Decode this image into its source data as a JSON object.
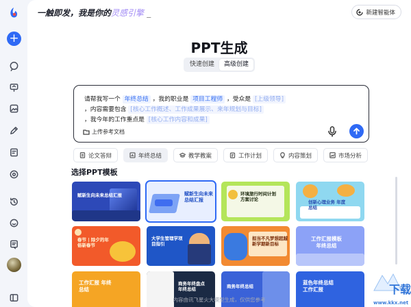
{
  "header": {
    "slogan_prefix": "一触即发，我是你的",
    "slogan_highlight": "灵感引擎",
    "slogan_cursor": "_",
    "new_agent_label": "新建智能体"
  },
  "main": {
    "title": "PPT生成",
    "modes": [
      "快速创建",
      "高级创建"
    ],
    "active_mode": "高级创建"
  },
  "prompt": {
    "line1": {
      "a": "请帮我写一个",
      "chip1": "年终总结",
      "b": "，我的职业是",
      "chip2": "项目工程师",
      "c": "，受众是",
      "chip3": "[上级领导]"
    },
    "line2": {
      "a": "，内容需要包含",
      "chip1": "[核心工作概述、工作成果展示、来年规划与目标]"
    },
    "line3": {
      "a": "，我今年的工作重点是",
      "chip1": "[核心工作内容和成果]"
    },
    "upload_label": "上传参考文档"
  },
  "categories": [
    {
      "label": "论文答辩",
      "icon": "document-icon",
      "active": false
    },
    {
      "label": "年终总结",
      "icon": "chart-icon",
      "active": true
    },
    {
      "label": "教学教案",
      "icon": "graduation-cap-icon",
      "active": false
    },
    {
      "label": "工作计划",
      "icon": "clipboard-icon",
      "active": false
    },
    {
      "label": "内容策划",
      "icon": "lightbulb-icon",
      "active": false
    },
    {
      "label": "市场分析",
      "icon": "trend-icon",
      "active": false
    }
  ],
  "templates_section": {
    "title": "选择PPT模板",
    "row1": [
      {
        "title": "赋新生向未来总结汇报",
        "bg": "#2d49b8"
      },
      {
        "title": "赋新生向未来\n总结汇报",
        "bg": "#e8efff",
        "selected": true
      },
      {
        "title": "环境旅行时间计划\n方案讨论",
        "bg": "#b4e55a"
      },
      {
        "title": "创新心理业务 年度\n总结",
        "bg": "#8fd8f0"
      }
    ],
    "row2": [
      {
        "title": "春节 | 除夕的年\n俗新春节",
        "bg": "#f25a2a"
      },
      {
        "title": "大学生管理学项\n目指引",
        "bg": "#1f56c7"
      },
      {
        "title": "担当不凡梦想超越\n新学期新目标",
        "bg": "#f28a32"
      },
      {
        "title": "工作汇报模板\n年终总结",
        "bg": "#8ca2f7"
      }
    ],
    "row3": [
      {
        "title": "工作汇报 年终\n总结",
        "bg": "#f5a524"
      },
      {
        "title": "商务年终盘点\n年终总结",
        "bg": "#1b2a44"
      },
      {
        "title": "商务年终总结",
        "bg": "#3a62d8"
      },
      {
        "title": "蓝色年终总结\n工作汇报",
        "bg": "#2f63e0"
      }
    ]
  },
  "footer": {
    "note": "内容由讯飞星火大模型生成，仅供您参考",
    "watermark": "www.kkx.net"
  },
  "colors": {
    "accent": "#2f6af5",
    "slogan_highlight": "#a28bf5"
  }
}
